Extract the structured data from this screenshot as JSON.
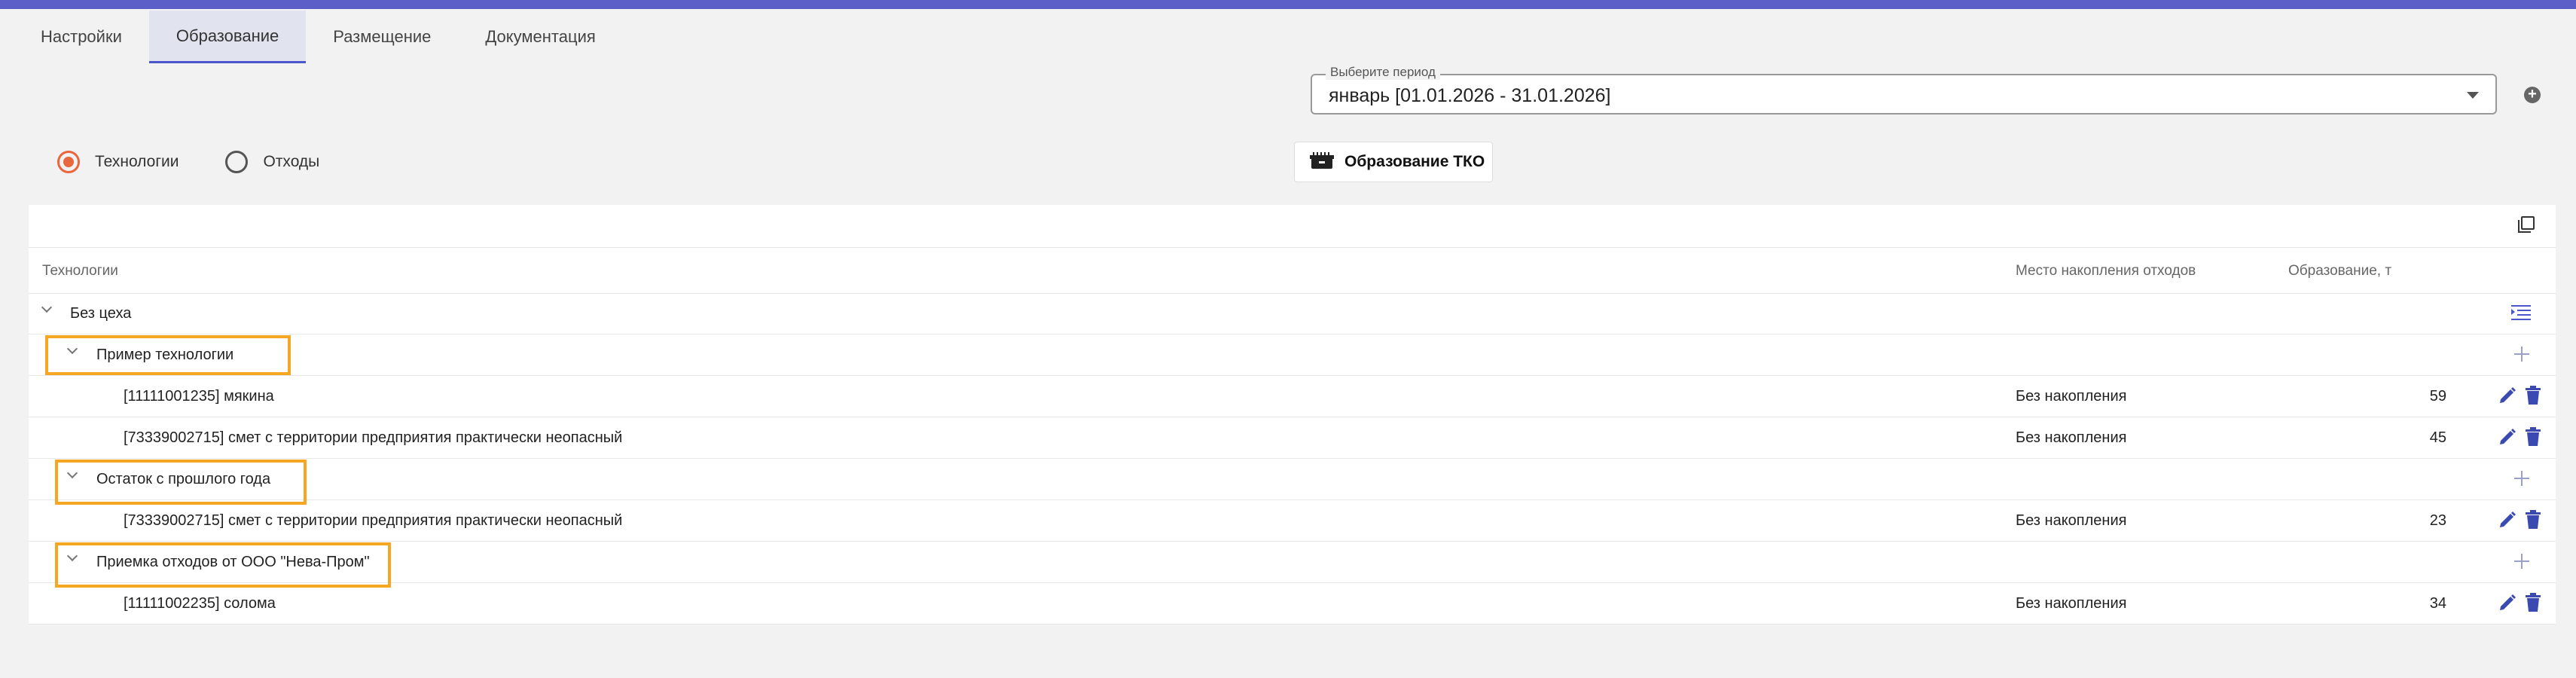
{
  "tabs": [
    "Настройки",
    "Образование",
    "Размещение",
    "Документация"
  ],
  "active_tab": "Образование",
  "period": {
    "label": "Выберите период",
    "value": "январь [01.01.2026 - 31.01.2026]"
  },
  "radios": [
    {
      "label": "Технологии",
      "selected": true
    },
    {
      "label": "Отходы",
      "selected": false
    }
  ],
  "tko_button": {
    "label": "Образование ТКО",
    "icon": "waste-container-icon"
  },
  "table": {
    "columns": {
      "tech": "Технологии",
      "place": "Место накопления отходов",
      "amount": "Образование, т"
    },
    "group": {
      "label": "Без цеха"
    },
    "subgroups": [
      {
        "label": "Пример технологии",
        "rows": [
          {
            "name": "[11111001235] мякина",
            "place": "Без накопления",
            "amount": "59"
          },
          {
            "name": "[73339002715] смет с территории предприятия практически неопасный",
            "place": "Без накопления",
            "amount": "45"
          }
        ]
      },
      {
        "label": "Остаток с прошлого года",
        "rows": [
          {
            "name": "[73339002715] смет с территории предприятия практически неопасный",
            "place": "Без накопления",
            "amount": "23"
          }
        ]
      },
      {
        "label": "Приемка отходов от ООО \"Нева-Пром\"",
        "rows": [
          {
            "name": "[11111002235] солома",
            "place": "Без накопления",
            "amount": "34"
          }
        ]
      }
    ]
  },
  "colors": {
    "accent": "#5b5fc7",
    "radio_active": "#e8673c",
    "highlight": "#f5a623",
    "action_icon": "#3a4ab0"
  }
}
